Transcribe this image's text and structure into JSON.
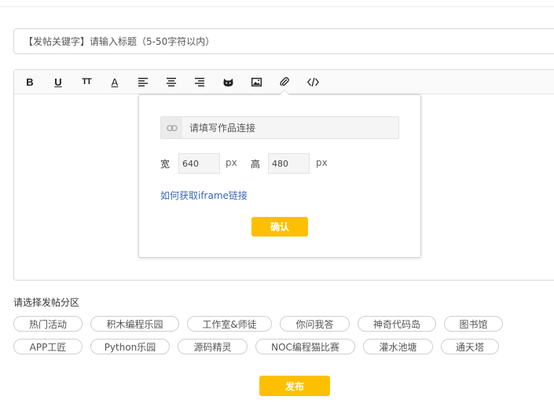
{
  "title_input": {
    "placeholder": "【发帖关键字】请输入标题（5-50字符以内）"
  },
  "toolbar": {
    "buttons": [
      {
        "name": "bold-button",
        "icon": "bold-icon",
        "glyph": "B"
      },
      {
        "name": "underline-button",
        "icon": "underline-icon",
        "glyph": "U"
      },
      {
        "name": "font-size-button",
        "icon": "text-size-icon",
        "glyph": "TT"
      },
      {
        "name": "font-color-button",
        "icon": "font-color-icon",
        "glyph": "A"
      },
      {
        "name": "align-left-button",
        "icon": "align-left-icon"
      },
      {
        "name": "align-center-button",
        "icon": "align-center-icon"
      },
      {
        "name": "align-right-button",
        "icon": "align-right-icon"
      },
      {
        "name": "emoji-button",
        "icon": "cat-icon"
      },
      {
        "name": "image-button",
        "icon": "image-icon"
      },
      {
        "name": "attachment-button",
        "icon": "paperclip-icon"
      },
      {
        "name": "code-button",
        "icon": "code-icon"
      }
    ]
  },
  "embed_popover": {
    "link_placeholder": "请填写作品连接",
    "width_label": "宽",
    "width_value": "640",
    "height_label": "高",
    "height_value": "480",
    "unit": "px",
    "help_link": "如何获取iframe链接",
    "confirm_label": "确认"
  },
  "section": {
    "label": "请选择发帖分区",
    "categories": [
      "热门活动",
      "积木编程乐园",
      "工作室&师徒",
      "你问我答",
      "神奇代码岛",
      "图书馆",
      "APP工匠",
      "Python乐园",
      "源码精灵",
      "NOC编程猫比赛",
      "灌水池塘",
      "通天塔"
    ]
  },
  "publish_label": "发布",
  "colors": {
    "accent": "#fdc000",
    "link": "#3a67b0"
  }
}
